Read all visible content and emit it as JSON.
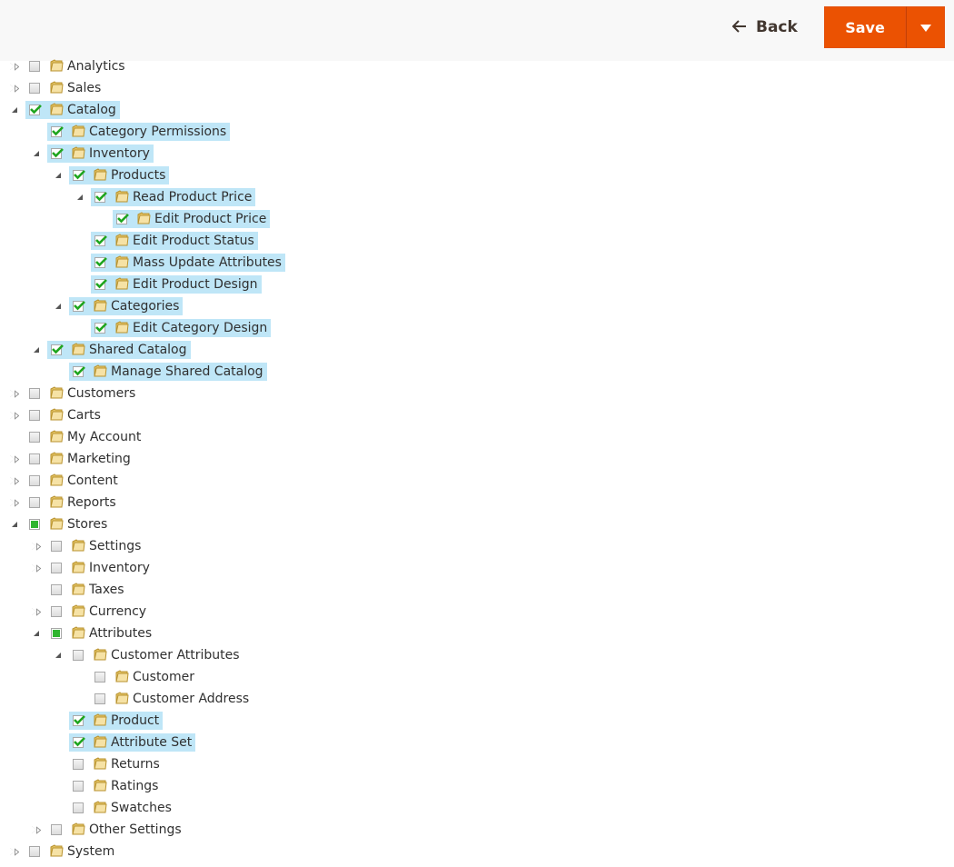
{
  "header": {
    "back_label": "Back",
    "save_label": "Save",
    "accent_color": "#eb5202"
  },
  "tree": [
    {
      "id": "analytics",
      "label": "Analytics",
      "depth": 0,
      "expander": "closed",
      "check": "none",
      "selected": false
    },
    {
      "id": "sales",
      "label": "Sales",
      "depth": 0,
      "expander": "closed",
      "check": "none",
      "selected": false
    },
    {
      "id": "catalog",
      "label": "Catalog",
      "depth": 0,
      "expander": "open",
      "check": "full",
      "selected": true
    },
    {
      "id": "category-permissions",
      "label": "Category Permissions",
      "depth": 1,
      "expander": "none",
      "check": "full",
      "selected": true
    },
    {
      "id": "inventory",
      "label": "Inventory",
      "depth": 1,
      "expander": "open",
      "check": "full",
      "selected": true
    },
    {
      "id": "products",
      "label": "Products",
      "depth": 2,
      "expander": "open",
      "check": "full",
      "selected": true
    },
    {
      "id": "read-product-price",
      "label": "Read Product Price",
      "depth": 3,
      "expander": "open",
      "check": "full",
      "selected": true
    },
    {
      "id": "edit-product-price",
      "label": "Edit Product Price",
      "depth": 4,
      "expander": "none",
      "check": "full",
      "selected": true
    },
    {
      "id": "edit-product-status",
      "label": "Edit Product Status",
      "depth": 3,
      "expander": "none",
      "check": "full",
      "selected": true
    },
    {
      "id": "mass-update-attributes",
      "label": "Mass Update Attributes",
      "depth": 3,
      "expander": "none",
      "check": "full",
      "selected": true
    },
    {
      "id": "edit-product-design",
      "label": "Edit Product Design",
      "depth": 3,
      "expander": "none",
      "check": "full",
      "selected": true
    },
    {
      "id": "categories",
      "label": "Categories",
      "depth": 2,
      "expander": "open",
      "check": "full",
      "selected": true
    },
    {
      "id": "edit-category-design",
      "label": "Edit Category Design",
      "depth": 3,
      "expander": "none",
      "check": "full",
      "selected": true
    },
    {
      "id": "shared-catalog",
      "label": "Shared Catalog",
      "depth": 1,
      "expander": "open",
      "check": "full",
      "selected": true
    },
    {
      "id": "manage-shared-catalog",
      "label": "Manage Shared Catalog",
      "depth": 2,
      "expander": "none",
      "check": "full",
      "selected": true
    },
    {
      "id": "customers",
      "label": "Customers",
      "depth": 0,
      "expander": "closed",
      "check": "none",
      "selected": false
    },
    {
      "id": "carts",
      "label": "Carts",
      "depth": 0,
      "expander": "closed",
      "check": "none",
      "selected": false
    },
    {
      "id": "my-account",
      "label": "My Account",
      "depth": 0,
      "expander": "none",
      "check": "none",
      "selected": false
    },
    {
      "id": "marketing",
      "label": "Marketing",
      "depth": 0,
      "expander": "closed",
      "check": "none",
      "selected": false
    },
    {
      "id": "content",
      "label": "Content",
      "depth": 0,
      "expander": "closed",
      "check": "none",
      "selected": false
    },
    {
      "id": "reports",
      "label": "Reports",
      "depth": 0,
      "expander": "closed",
      "check": "none",
      "selected": false
    },
    {
      "id": "stores",
      "label": "Stores",
      "depth": 0,
      "expander": "open",
      "check": "partial",
      "selected": false
    },
    {
      "id": "settings",
      "label": "Settings",
      "depth": 1,
      "expander": "closed",
      "check": "none",
      "selected": false
    },
    {
      "id": "stores-inventory",
      "label": "Inventory",
      "depth": 1,
      "expander": "closed",
      "check": "none",
      "selected": false
    },
    {
      "id": "taxes",
      "label": "Taxes",
      "depth": 1,
      "expander": "none",
      "check": "none",
      "selected": false
    },
    {
      "id": "currency",
      "label": "Currency",
      "depth": 1,
      "expander": "closed",
      "check": "none",
      "selected": false
    },
    {
      "id": "attributes",
      "label": "Attributes",
      "depth": 1,
      "expander": "open",
      "check": "partial",
      "selected": false
    },
    {
      "id": "customer-attributes",
      "label": "Customer Attributes",
      "depth": 2,
      "expander": "open",
      "check": "none",
      "selected": false
    },
    {
      "id": "customer",
      "label": "Customer",
      "depth": 3,
      "expander": "none",
      "check": "none",
      "selected": false
    },
    {
      "id": "customer-address",
      "label": "Customer Address",
      "depth": 3,
      "expander": "none",
      "check": "none",
      "selected": false
    },
    {
      "id": "product",
      "label": "Product",
      "depth": 2,
      "expander": "none",
      "check": "full",
      "selected": true
    },
    {
      "id": "attribute-set",
      "label": "Attribute Set",
      "depth": 2,
      "expander": "none",
      "check": "full",
      "selected": true
    },
    {
      "id": "returns",
      "label": "Returns",
      "depth": 2,
      "expander": "none",
      "check": "none",
      "selected": false
    },
    {
      "id": "ratings",
      "label": "Ratings",
      "depth": 2,
      "expander": "none",
      "check": "none",
      "selected": false
    },
    {
      "id": "swatches",
      "label": "Swatches",
      "depth": 2,
      "expander": "none",
      "check": "none",
      "selected": false
    },
    {
      "id": "other-settings",
      "label": "Other Settings",
      "depth": 1,
      "expander": "closed",
      "check": "none",
      "selected": false
    },
    {
      "id": "system",
      "label": "System",
      "depth": 0,
      "expander": "closed",
      "check": "none",
      "selected": false
    }
  ]
}
